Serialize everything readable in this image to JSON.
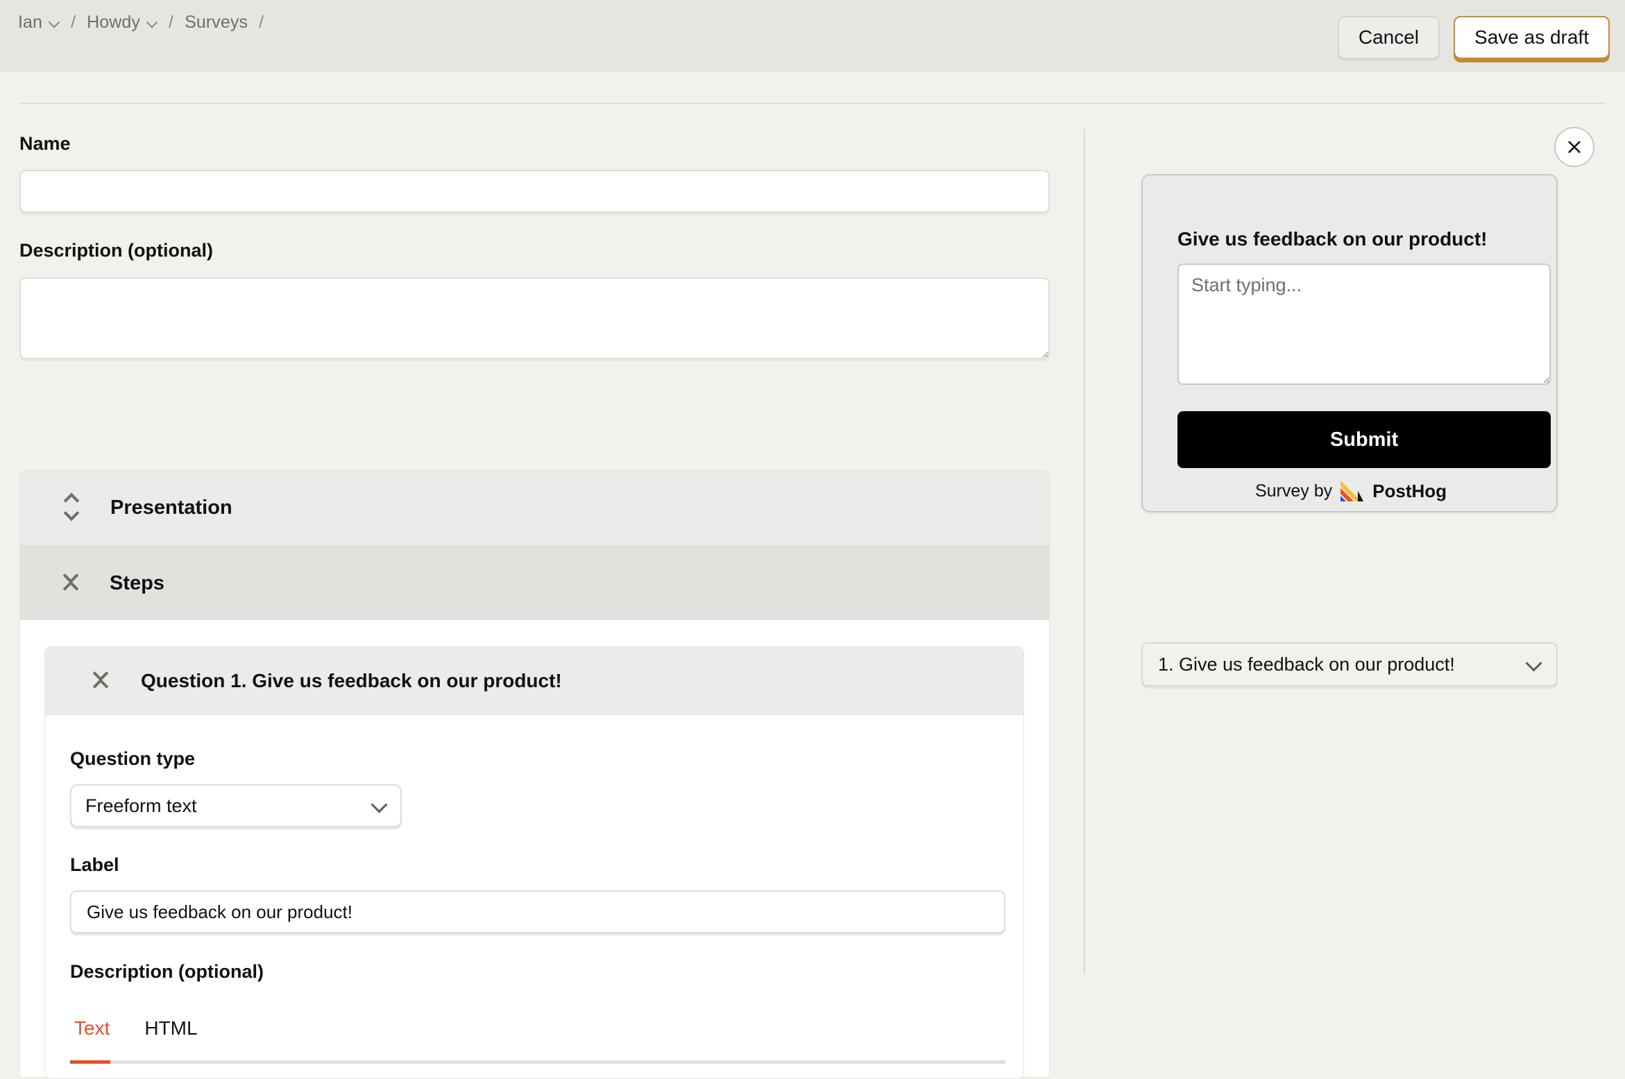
{
  "breadcrumb": {
    "items": [
      {
        "label": "Ian",
        "has_chevron": true
      },
      {
        "label": "Howdy",
        "has_chevron": true
      },
      {
        "label": "Surveys",
        "has_chevron": false
      }
    ],
    "separator": "/",
    "trailing_separator": "/"
  },
  "toolbar": {
    "cancel_label": "Cancel",
    "save_draft_label": "Save as draft"
  },
  "form": {
    "name_label": "Name",
    "name_value": "",
    "name_placeholder": "",
    "description_label": "Description (optional)",
    "description_value": "",
    "description_placeholder": ""
  },
  "sections": {
    "presentation": {
      "title": "Presentation",
      "state": "collapsed",
      "toggle_icon": "chevrons-expand-icon"
    },
    "steps": {
      "title": "Steps",
      "state": "expanded",
      "toggle_icon": "chevrons-collapse-icon"
    }
  },
  "question": {
    "header_title": "Question 1. Give us feedback on our product!",
    "toggle_icon": "chevrons-collapse-icon",
    "type_label": "Question type",
    "type_value": "Freeform text",
    "label_label": "Label",
    "label_value": "Give us feedback on our product!",
    "description_label": "Description (optional)",
    "tabs": [
      {
        "label": "Text",
        "active": true
      },
      {
        "label": "HTML",
        "active": false
      }
    ]
  },
  "preview": {
    "close_label": "Close",
    "title": "Give us feedback on our product!",
    "textarea_value": "",
    "textarea_placeholder": "Start typing...",
    "submit_label": "Submit",
    "survey_by_text": "Survey by",
    "brand_name": "PostHog",
    "question_select_value": "1. Give us feedback on our product!"
  },
  "colors": {
    "page_bg": "#F2F2ED",
    "header_bg": "#E5E6E0",
    "accent_orange": "#E3502A",
    "save_border": "#C48A34",
    "section_bg": "#EAEAE8",
    "steps_bg": "#E1E2DD",
    "preview_bg": "#EAEAEA",
    "submit_bg": "#000000"
  }
}
